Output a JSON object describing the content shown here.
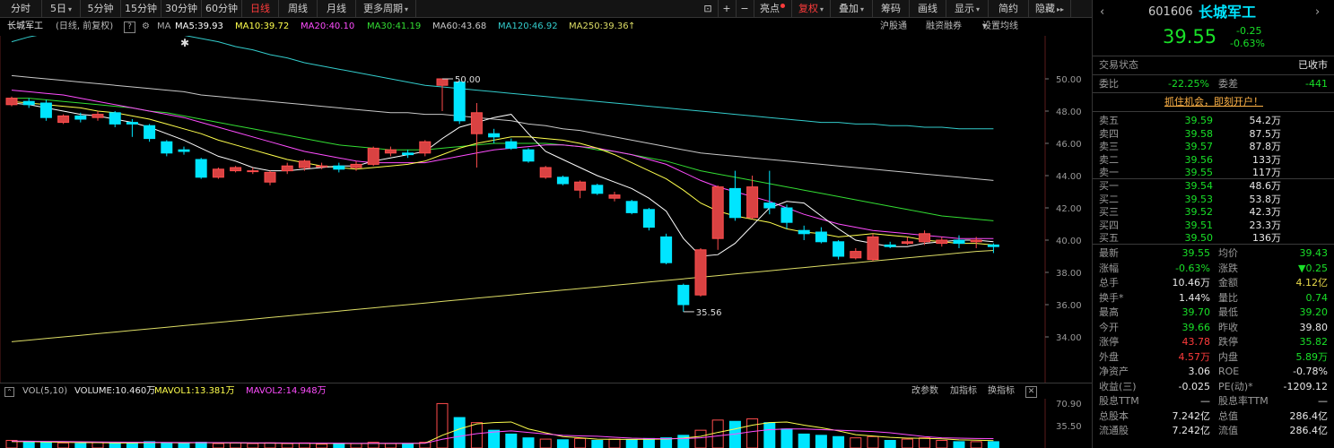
{
  "toolbar": {
    "tabs": [
      "分时",
      "5日",
      "5分钟",
      "15分钟",
      "30分钟",
      "60分钟",
      "日线",
      "周线",
      "月线",
      "更多周期"
    ],
    "tools": [
      "亮点",
      "复权",
      "叠加",
      "筹码",
      "画线",
      "显示",
      "简约",
      "隐藏"
    ]
  },
  "stock_header": {
    "name": "长城军工",
    "mode": "(日线, 前复权)",
    "ma_label": "MA",
    "ma_values": [
      "MA5:39.93",
      "MA10:39.72",
      "MA20:40.10",
      "MA30:41.19",
      "MA60:43.68",
      "MA120:46.92",
      "MA250:39.36"
    ],
    "links": [
      "沪股通",
      "融资融券",
      "设置均线"
    ]
  },
  "colors": {
    "up": "#ff4d4d",
    "down": "#00e5ff",
    "ma5": "#ffffff",
    "ma10": "#ffff4d",
    "ma20": "#ff4dff",
    "ma30": "#33dd33",
    "ma60": "#c8c8c8",
    "ma120": "#33cccc",
    "ma250": "#dddd66"
  },
  "chart_data": {
    "type": "candlestick",
    "y_axis_ticks": [
      "50.00",
      "48.00",
      "46.00",
      "44.00",
      "42.00",
      "40.00",
      "38.00",
      "36.00",
      "34.00"
    ],
    "ylim": [
      33.0,
      51.0
    ],
    "high_label": "50.00",
    "low_label": "35.56",
    "candles": [
      {
        "o": 48.4,
        "c": 48.8,
        "h": 48.9,
        "l": 48.3
      },
      {
        "o": 48.6,
        "c": 48.4,
        "h": 48.8,
        "l": 48.2
      },
      {
        "o": 48.5,
        "c": 47.6,
        "h": 48.7,
        "l": 47.4
      },
      {
        "o": 47.3,
        "c": 47.7,
        "h": 47.8,
        "l": 47.2
      },
      {
        "o": 47.7,
        "c": 47.5,
        "h": 47.9,
        "l": 47.3
      },
      {
        "o": 47.6,
        "c": 47.8,
        "h": 48.0,
        "l": 47.4
      },
      {
        "o": 47.9,
        "c": 47.2,
        "h": 48.0,
        "l": 47.0
      },
      {
        "o": 47.3,
        "c": 47.2,
        "h": 47.5,
        "l": 46.4
      },
      {
        "o": 47.1,
        "c": 46.3,
        "h": 47.2,
        "l": 46.1
      },
      {
        "o": 46.1,
        "c": 45.4,
        "h": 46.2,
        "l": 45.2
      },
      {
        "o": 45.6,
        "c": 45.5,
        "h": 45.8,
        "l": 45.3
      },
      {
        "o": 45.0,
        "c": 43.9,
        "h": 45.1,
        "l": 43.8
      },
      {
        "o": 43.9,
        "c": 44.4,
        "h": 44.5,
        "l": 43.8
      },
      {
        "o": 44.3,
        "c": 44.5,
        "h": 44.6,
        "l": 44.2
      },
      {
        "o": 44.3,
        "c": 44.3,
        "h": 44.5,
        "l": 44.1
      },
      {
        "o": 43.6,
        "c": 44.2,
        "h": 44.3,
        "l": 43.4
      },
      {
        "o": 44.3,
        "c": 44.6,
        "h": 44.8,
        "l": 44.1
      },
      {
        "o": 44.5,
        "c": 44.9,
        "h": 45.0,
        "l": 44.3
      },
      {
        "o": 44.6,
        "c": 44.6,
        "h": 44.8,
        "l": 44.4
      },
      {
        "o": 44.6,
        "c": 44.4,
        "h": 44.8,
        "l": 44.2
      },
      {
        "o": 44.5,
        "c": 44.7,
        "h": 44.9,
        "l": 44.3
      },
      {
        "o": 44.7,
        "c": 45.7,
        "h": 45.8,
        "l": 44.6
      },
      {
        "o": 45.4,
        "c": 45.6,
        "h": 45.8,
        "l": 45.2
      },
      {
        "o": 45.4,
        "c": 45.3,
        "h": 45.6,
        "l": 45.1
      },
      {
        "o": 45.4,
        "c": 46.1,
        "h": 46.2,
        "l": 45.2
      },
      {
        "o": 49.6,
        "c": 50.0,
        "h": 50.0,
        "l": 48.0
      },
      {
        "o": 49.8,
        "c": 47.4,
        "h": 49.9,
        "l": 47.2
      },
      {
        "o": 46.6,
        "c": 47.9,
        "h": 48.5,
        "l": 44.5
      },
      {
        "o": 46.6,
        "c": 46.4,
        "h": 46.9,
        "l": 46.0
      },
      {
        "o": 46.1,
        "c": 45.7,
        "h": 46.3,
        "l": 45.6
      },
      {
        "o": 45.6,
        "c": 44.9,
        "h": 45.7,
        "l": 44.8
      },
      {
        "o": 43.9,
        "c": 44.5,
        "h": 44.6,
        "l": 43.8
      },
      {
        "o": 43.9,
        "c": 43.5,
        "h": 44.0,
        "l": 43.4
      },
      {
        "o": 43.1,
        "c": 43.6,
        "h": 43.7,
        "l": 42.6
      },
      {
        "o": 43.4,
        "c": 42.9,
        "h": 43.5,
        "l": 42.8
      },
      {
        "o": 42.6,
        "c": 42.8,
        "h": 43.0,
        "l": 42.4
      },
      {
        "o": 42.4,
        "c": 41.7,
        "h": 42.5,
        "l": 41.6
      },
      {
        "o": 41.9,
        "c": 40.8,
        "h": 42.0,
        "l": 40.6
      },
      {
        "o": 40.2,
        "c": 38.6,
        "h": 40.4,
        "l": 38.5
      },
      {
        "o": 37.2,
        "c": 36.0,
        "h": 37.3,
        "l": 35.56
      },
      {
        "o": 36.6,
        "c": 39.4,
        "h": 39.5,
        "l": 36.5
      },
      {
        "o": 40.1,
        "c": 43.3,
        "h": 43.4,
        "l": 39.4
      },
      {
        "o": 43.2,
        "c": 41.4,
        "h": 44.3,
        "l": 41.2
      },
      {
        "o": 41.4,
        "c": 43.3,
        "h": 44.0,
        "l": 41.3
      },
      {
        "o": 42.3,
        "c": 42.0,
        "h": 44.3,
        "l": 41.6
      },
      {
        "o": 42.0,
        "c": 41.1,
        "h": 42.2,
        "l": 40.7
      },
      {
        "o": 40.6,
        "c": 40.4,
        "h": 40.9,
        "l": 40.0
      },
      {
        "o": 40.5,
        "c": 39.9,
        "h": 40.8,
        "l": 39.8
      },
      {
        "o": 39.9,
        "c": 39.0,
        "h": 40.0,
        "l": 38.8
      },
      {
        "o": 38.9,
        "c": 39.3,
        "h": 39.5,
        "l": 38.8
      },
      {
        "o": 38.8,
        "c": 40.2,
        "h": 40.4,
        "l": 38.7
      },
      {
        "o": 39.7,
        "c": 39.6,
        "h": 39.9,
        "l": 39.5
      },
      {
        "o": 39.8,
        "c": 39.9,
        "h": 40.2,
        "l": 39.7
      },
      {
        "o": 39.9,
        "c": 40.4,
        "h": 40.6,
        "l": 39.7
      },
      {
        "o": 39.8,
        "c": 40.0,
        "h": 40.2,
        "l": 39.6
      },
      {
        "o": 40.0,
        "c": 39.8,
        "h": 40.3,
        "l": 39.5
      },
      {
        "o": 39.9,
        "c": 40.0,
        "h": 40.2,
        "l": 39.5
      },
      {
        "o": 39.7,
        "c": 39.6,
        "h": 39.8,
        "l": 39.2
      }
    ],
    "volume": {
      "y_axis_ticks": [
        "70.90",
        "35.50"
      ],
      "ylim": [
        0,
        72
      ],
      "values": [
        12,
        10,
        9,
        8,
        7,
        9,
        8,
        7,
        10,
        8,
        8,
        9,
        7,
        8,
        7,
        8,
        7,
        8,
        6,
        7,
        7,
        9,
        7,
        7,
        9,
        70,
        48,
        40,
        28,
        22,
        16,
        14,
        13,
        15,
        12,
        14,
        13,
        15,
        16,
        20,
        28,
        44,
        42,
        46,
        40,
        30,
        22,
        20,
        18,
        16,
        18,
        12,
        14,
        16,
        12,
        10,
        10,
        10
      ],
      "ma5": [
        10,
        10,
        9.5,
        9,
        8.5,
        8.5,
        8,
        8,
        8.5,
        8.5,
        8,
        8.5,
        8,
        8,
        7.8,
        7.6,
        7.4,
        7.5,
        7.2,
        7.2,
        7,
        7.2,
        7.2,
        7.2,
        7.6,
        20,
        30,
        38,
        40,
        41,
        30,
        24,
        18,
        16,
        14,
        13.6,
        13.6,
        13.8,
        14.2,
        15.6,
        18.4,
        24.6,
        30,
        36,
        40,
        41,
        36,
        32,
        27,
        21,
        18.8,
        16.8,
        15.6,
        15.2,
        14.4,
        12.8,
        12.4,
        11.6
      ],
      "ma10": [
        11,
        10.8,
        10.5,
        10.2,
        9.9,
        9.6,
        9.4,
        9.1,
        9,
        8.8,
        8.6,
        8.6,
        8.5,
        8.4,
        8.2,
        8.1,
        7.9,
        7.8,
        7.7,
        7.6,
        7.5,
        7.5,
        7.4,
        7.4,
        7.5,
        13.8,
        18.4,
        22.6,
        25.3,
        27,
        24.5,
        22,
        20,
        19,
        18.5,
        17,
        15.5,
        14.8,
        14.6,
        14.8,
        16,
        19,
        22,
        26,
        29,
        30,
        30,
        29,
        28,
        27,
        26,
        24,
        21,
        18,
        16,
        15.5,
        15,
        14.9
      ]
    },
    "ma_series": {
      "ma5": [
        48.5,
        48.4,
        48.2,
        48.0,
        47.8,
        47.7,
        47.5,
        47.3,
        47.0,
        46.6,
        46.2,
        45.7,
        45.2,
        44.9,
        44.5,
        44.3,
        44.3,
        44.4,
        44.5,
        44.6,
        44.6,
        44.9,
        45.1,
        45.3,
        45.5,
        46.3,
        47.0,
        47.3,
        47.6,
        47.8,
        46.6,
        45.5,
        45.0,
        44.5,
        44.0,
        43.6,
        43.2,
        42.6,
        41.8,
        40.1,
        39.0,
        39.1,
        39.8,
        40.9,
        42.0,
        42.4,
        42.3,
        41.5,
        40.7,
        40.0,
        39.8,
        39.6,
        39.6,
        39.8,
        39.9,
        40.0,
        40.0,
        39.9
      ],
      "ma10": [
        48.6,
        48.5,
        48.4,
        48.3,
        48.2,
        48.0,
        47.9,
        47.7,
        47.5,
        47.2,
        46.9,
        46.6,
        46.2,
        45.9,
        45.6,
        45.3,
        45.0,
        44.8,
        44.6,
        44.5,
        44.4,
        44.5,
        44.6,
        44.7,
        44.9,
        45.3,
        45.7,
        46.0,
        46.2,
        46.4,
        46.4,
        46.3,
        46.2,
        46.0,
        45.7,
        45.3,
        44.8,
        44.3,
        43.8,
        43.1,
        42.3,
        41.8,
        41.5,
        41.3,
        41.1,
        40.7,
        40.5,
        40.4,
        40.2,
        40.3,
        40.4,
        40.3,
        40.2,
        40.0,
        39.9,
        39.8,
        39.8,
        39.7
      ],
      "ma20": [
        49.3,
        49.2,
        49.1,
        49.0,
        48.8,
        48.6,
        48.4,
        48.2,
        48.0,
        47.8,
        47.6,
        47.3,
        47.0,
        46.7,
        46.4,
        46.1,
        45.8,
        45.5,
        45.3,
        45.1,
        44.9,
        44.8,
        44.8,
        44.8,
        44.8,
        45.0,
        45.2,
        45.4,
        45.6,
        45.7,
        45.8,
        45.9,
        45.9,
        45.8,
        45.7,
        45.5,
        45.3,
        45.0,
        44.7,
        44.2,
        43.7,
        43.3,
        43.0,
        42.7,
        42.4,
        42.0,
        41.6,
        41.3,
        41.0,
        40.8,
        40.6,
        40.5,
        40.4,
        40.3,
        40.2,
        40.1,
        40.1,
        40.1
      ],
      "ma30": [
        48.8,
        48.8,
        48.7,
        48.6,
        48.5,
        48.4,
        48.3,
        48.2,
        48.0,
        47.9,
        47.7,
        47.5,
        47.3,
        47.1,
        46.9,
        46.7,
        46.5,
        46.3,
        46.1,
        45.9,
        45.8,
        45.7,
        45.6,
        45.6,
        45.6,
        45.7,
        45.8,
        45.9,
        46.0,
        46.0,
        46.0,
        46.0,
        45.9,
        45.8,
        45.6,
        45.5,
        45.3,
        45.1,
        44.9,
        44.6,
        44.3,
        44.1,
        43.9,
        43.7,
        43.5,
        43.3,
        43.1,
        42.9,
        42.7,
        42.5,
        42.3,
        42.1,
        41.9,
        41.7,
        41.5,
        41.4,
        41.3,
        41.2
      ],
      "ma60": [
        50.2,
        50.1,
        50.0,
        49.9,
        49.8,
        49.7,
        49.6,
        49.5,
        49.4,
        49.3,
        49.2,
        49.0,
        48.9,
        48.8,
        48.7,
        48.6,
        48.5,
        48.4,
        48.3,
        48.2,
        48.1,
        48.0,
        47.9,
        47.9,
        47.8,
        47.8,
        47.7,
        47.6,
        47.5,
        47.4,
        47.2,
        47.1,
        46.9,
        46.8,
        46.6,
        46.4,
        46.2,
        46.0,
        45.8,
        45.6,
        45.4,
        45.3,
        45.2,
        45.1,
        45.0,
        44.9,
        44.8,
        44.7,
        44.6,
        44.5,
        44.4,
        44.3,
        44.2,
        44.1,
        44.0,
        43.9,
        43.8,
        43.7
      ],
      "ma120": [
        52.3,
        52.6,
        52.8,
        52.9,
        53.0,
        53.0,
        53.0,
        53.0,
        52.9,
        52.8,
        52.7,
        52.5,
        52.3,
        52.0,
        51.8,
        51.5,
        51.3,
        51.0,
        50.8,
        50.6,
        50.4,
        50.2,
        50.0,
        49.8,
        49.6,
        49.5,
        49.4,
        49.3,
        49.2,
        49.1,
        49.0,
        48.9,
        48.8,
        48.7,
        48.6,
        48.5,
        48.4,
        48.3,
        48.2,
        48.1,
        48.0,
        47.9,
        47.8,
        47.7,
        47.6,
        47.5,
        47.4,
        47.3,
        47.3,
        47.2,
        47.2,
        47.1,
        47.1,
        47.0,
        47.0,
        46.9,
        46.9,
        46.9
      ],
      "ma250": [
        33.7,
        33.8,
        33.9,
        34.0,
        34.1,
        34.2,
        34.3,
        34.4,
        34.5,
        34.6,
        34.7,
        34.8,
        34.9,
        35.0,
        35.1,
        35.2,
        35.3,
        35.4,
        35.5,
        35.6,
        35.7,
        35.8,
        35.9,
        36.0,
        36.1,
        36.2,
        36.3,
        36.4,
        36.5,
        36.6,
        36.7,
        36.8,
        36.9,
        37.0,
        37.1,
        37.2,
        37.3,
        37.4,
        37.5,
        37.6,
        37.7,
        37.8,
        37.9,
        38.0,
        38.1,
        38.2,
        38.3,
        38.4,
        38.5,
        38.6,
        38.7,
        38.8,
        38.9,
        39.0,
        39.1,
        39.2,
        39.3,
        39.36
      ]
    }
  },
  "volume_header": {
    "label": "VOL(5,10)",
    "volume": "VOLUME:10.460万",
    "mavol1": "MAVOL1:13.381万",
    "mavol2": "MAVOL2:14.948万",
    "links": [
      "改参数",
      "加指标",
      "换指标"
    ]
  },
  "quote": {
    "code": "601606",
    "name": "长城军工",
    "price": "39.55",
    "change": "-0.25",
    "change_pct": "-0.63%",
    "status_label": "交易状态",
    "status_value": "已收市",
    "weibi_label": "委比",
    "weibi_value": "-22.25%",
    "weicha_label": "委差",
    "weicha_value": "-441",
    "promo": "抓住机会，即刻开户！",
    "asks": [
      {
        "label": "卖五",
        "price": "39.59",
        "vol": "54.2万"
      },
      {
        "label": "卖四",
        "price": "39.58",
        "vol": "87.5万"
      },
      {
        "label": "卖三",
        "price": "39.57",
        "vol": "87.8万"
      },
      {
        "label": "卖二",
        "price": "39.56",
        "vol": "133万"
      },
      {
        "label": "卖一",
        "price": "39.55",
        "vol": "117万"
      }
    ],
    "bids": [
      {
        "label": "买一",
        "price": "39.54",
        "vol": "48.6万"
      },
      {
        "label": "买二",
        "price": "39.53",
        "vol": "53.8万"
      },
      {
        "label": "买三",
        "price": "39.52",
        "vol": "42.3万"
      },
      {
        "label": "买四",
        "price": "39.51",
        "vol": "23.3万"
      },
      {
        "label": "买五",
        "price": "39.50",
        "vol": "136万"
      }
    ],
    "stats": [
      {
        "l1": "最新",
        "v1": "39.55",
        "c1": "green",
        "l2": "均价",
        "v2": "39.43",
        "c2": "green"
      },
      {
        "l1": "涨幅",
        "v1": "-0.63%",
        "c1": "green",
        "l2": "涨跌",
        "v2": "▼0.25",
        "c2": "green"
      },
      {
        "l1": "总手",
        "v1": "10.46万",
        "c1": "white",
        "l2": "金额",
        "v2": "4.12亿",
        "c2": "yellow"
      },
      {
        "l1": "换手*",
        "v1": "1.44%",
        "c1": "white",
        "l2": "量比",
        "v2": "0.74",
        "c2": "green"
      },
      {
        "l1": "最高",
        "v1": "39.70",
        "c1": "green",
        "l2": "最低",
        "v2": "39.20",
        "c2": "green"
      },
      {
        "l1": "今开",
        "v1": "39.66",
        "c1": "green",
        "l2": "昨收",
        "v2": "39.80",
        "c2": "white"
      },
      {
        "l1": "涨停",
        "v1": "43.78",
        "c1": "red",
        "l2": "跌停",
        "v2": "35.82",
        "c2": "green"
      },
      {
        "l1": "外盘",
        "v1": "4.57万",
        "c1": "red",
        "l2": "内盘",
        "v2": "5.89万",
        "c2": "green"
      },
      {
        "l1": "净资产",
        "v1": "3.06",
        "c1": "white",
        "l2": "ROE",
        "v2": "-0.78%",
        "c2": "white"
      },
      {
        "l1": "收益(三)",
        "v1": "-0.025",
        "c1": "white",
        "l2": "PE(动)*",
        "v2": "-1209.12",
        "c2": "white"
      },
      {
        "l1": "股息TTM",
        "v1": "—",
        "c1": "white",
        "l2": "股息率TTM",
        "v2": "—",
        "c2": "white"
      },
      {
        "l1": "总股本",
        "v1": "7.242亿",
        "c1": "white",
        "l2": "总值",
        "v2": "286.4亿",
        "c2": "white"
      },
      {
        "l1": "流通股",
        "v1": "7.242亿",
        "c1": "white",
        "l2": "流值",
        "v2": "286.4亿",
        "c2": "white"
      }
    ]
  }
}
